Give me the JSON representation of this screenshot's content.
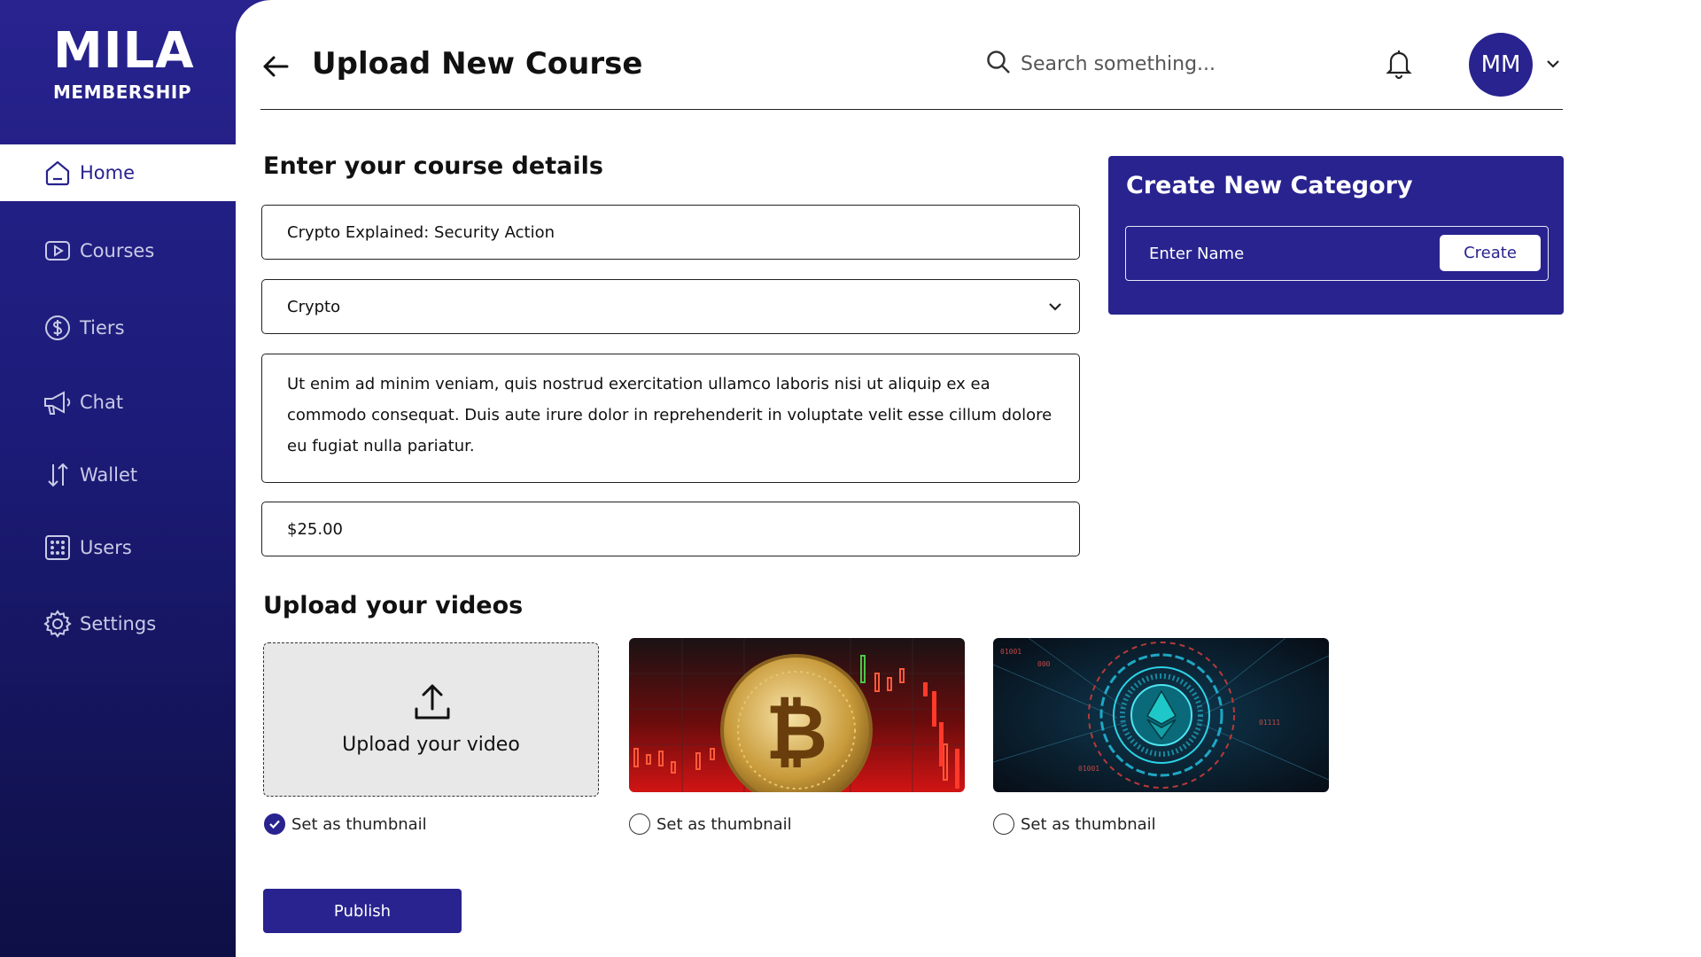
{
  "brand": {
    "logo_top": "MILA",
    "logo_bottom": "MEMBERSHIP"
  },
  "sidebar": {
    "items": [
      {
        "label": "Home",
        "icon": "home-icon",
        "active": true
      },
      {
        "label": "Courses",
        "icon": "play-icon",
        "active": false
      },
      {
        "label": "Tiers",
        "icon": "dollar-icon",
        "active": false
      },
      {
        "label": "Chat",
        "icon": "megaphone-icon",
        "active": false
      },
      {
        "label": "Wallet",
        "icon": "transfer-arrows-icon",
        "active": false
      },
      {
        "label": "Users",
        "icon": "users-grid-icon",
        "active": false
      },
      {
        "label": "Settings",
        "icon": "gear-icon",
        "active": false
      }
    ]
  },
  "header": {
    "title": "Upload New Course",
    "search_placeholder": "Search something...",
    "avatar_initials": "MM"
  },
  "details": {
    "section_title": "Enter your course details",
    "course_title": "Crypto Explained: Security Action",
    "category": "Crypto",
    "description": "Ut enim ad minim veniam, quis nostrud exercitation ullamco laboris nisi ut aliquip ex ea commodo consequat. Duis aute irure dolor in reprehenderit in voluptate velit esse cillum dolore eu fugiat nulla pariatur.",
    "price": "$25.00"
  },
  "category_card": {
    "title": "Create New Category",
    "input_placeholder": "Enter Name",
    "create_label": "Create"
  },
  "videos": {
    "section_title": "Upload your videos",
    "upload_label": "Upload your video",
    "items": [
      {
        "thumbnail_label": "Set as thumbnail",
        "selected": true
      },
      {
        "thumbnail_label": "Set as thumbnail",
        "selected": false
      },
      {
        "thumbnail_label": "Set as thumbnail",
        "selected": false
      }
    ]
  },
  "publish_label": "Publish",
  "colors": {
    "primary": "#28238f",
    "sidebar_dark": "#0e0f45"
  }
}
